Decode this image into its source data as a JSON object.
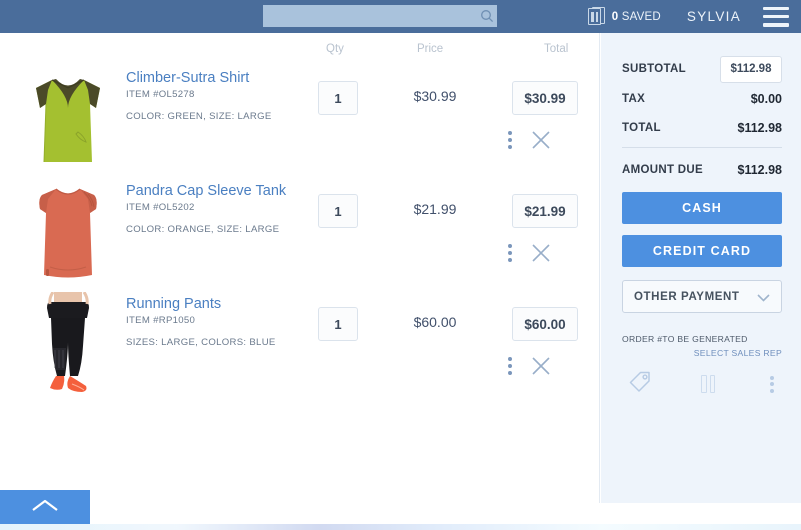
{
  "header": {
    "search_placeholder": "",
    "search_value": "",
    "search_icon": "search-icon",
    "saved_icon": "saved-orders-icon",
    "saved_count": "0",
    "saved_label": "SAVED",
    "user_name": "SYLVIA",
    "menu_icon": "hamburger-menu-icon"
  },
  "cart": {
    "columns": {
      "qty": "Qty",
      "price": "Price",
      "total": "Total"
    },
    "row_menu_icon": "kebab-menu-icon",
    "row_remove_icon": "close-x-icon",
    "items": [
      {
        "name": "Climber-Sutra Shirt",
        "sku": "ITEM #OL5278",
        "options": "COLOR: GREEN, SIZE: LARGE",
        "qty": "1",
        "price": "$30.99",
        "total": "$30.99",
        "thumb": "green-raglan-shirt"
      },
      {
        "name": "Pandra Cap Sleeve Tank",
        "sku": "ITEM #OL5202",
        "options": "COLOR: ORANGE, SIZE: LARGE",
        "qty": "1",
        "price": "$21.99",
        "total": "$21.99",
        "thumb": "orange-cap-sleeve-tank"
      },
      {
        "name": "Running Pants",
        "sku": "ITEM #RP1050",
        "options": "SIZES: LARGE, COLORS: BLUE",
        "qty": "1",
        "price": "$60.00",
        "total": "$60.00",
        "thumb": "black-running-pants"
      }
    ]
  },
  "sidebar": {
    "subtotal_label": "SUBTOTAL",
    "subtotal_value": "$112.98",
    "tax_label": "TAX",
    "tax_value": "$0.00",
    "total_label": "TOTAL",
    "total_value": "$112.98",
    "amount_due_label": "AMOUNT DUE",
    "amount_due_value": "$112.98",
    "cash_button": "CASH",
    "credit_card_button": "CREDIT CARD",
    "other_payment_button": "OTHER PAYMENT",
    "other_payment_icon": "chevron-down-icon",
    "order_number_note": "ORDER #TO BE GENERATED",
    "select_sales_rep": "SELECT SALES REP",
    "action_icons": [
      "discount-tag-icon",
      "hold-order-icon",
      "more-options-icon"
    ]
  },
  "footer": {
    "collapse_icon": "chevron-up-icon"
  },
  "colors": {
    "header_bg": "#4a6d9b",
    "sidebar_bg": "#eef4fb",
    "accent_blue": "#4d90e0",
    "link_blue": "#4a7fc1",
    "search_bg": "#a9c2dc"
  }
}
